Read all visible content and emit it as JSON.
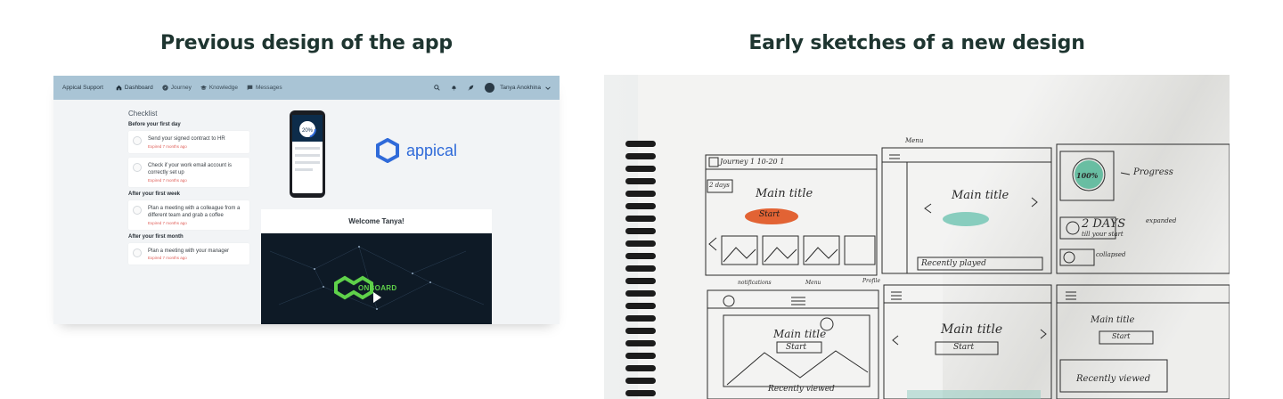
{
  "headings": {
    "left": "Previous design of the app",
    "right": "Early sketches of a new design"
  },
  "app": {
    "brand": "Appical Support",
    "nav": [
      {
        "label": "Dashboard",
        "icon": "home-icon",
        "active": true
      },
      {
        "label": "Journey",
        "icon": "compass-icon",
        "active": false
      },
      {
        "label": "Knowledge",
        "icon": "graduation-cap-icon",
        "active": false
      },
      {
        "label": "Messages",
        "icon": "chat-icon",
        "active": false
      }
    ],
    "user_name": "Tanya Anokhina",
    "checklist": {
      "title": "Checklist",
      "sections": [
        {
          "name": "Before your first day",
          "items": [
            {
              "text": "Send your signed contract to HR",
              "status": "Expired 7 months ago"
            },
            {
              "text": "Check if your work email account is correctly set up",
              "status": "Expired 7 months ago"
            }
          ]
        },
        {
          "name": "After your first week",
          "items": [
            {
              "text": "Plan a meeting with a colleague from a different team and grab a coffee",
              "status": "Expired 7 months ago"
            }
          ]
        },
        {
          "name": "After your first month",
          "items": [
            {
              "text": "Plan a meeting with your manager",
              "status": "Expired 7 months ago"
            }
          ]
        }
      ]
    },
    "phone_progress": "20%",
    "logo_text": "appical",
    "welcome": "Welcome Tanya!",
    "video_text": "ONBOARD"
  },
  "sketch": {
    "labels": {
      "journey": "Journey 1 10-20 1",
      "days_small": "2 days",
      "main_title": "Main title",
      "start": "Start",
      "recently_played": "Recently played",
      "recently_viewed": "Recently viewed",
      "menu": "Menu",
      "progress_value": "100%",
      "progress": "Progress",
      "days_big": "2 DAYS",
      "fill_your_sheet": "till your start",
      "expanded": "expanded",
      "collapsed": "collapsed",
      "notifications": "notifications",
      "profile": "Profile"
    }
  }
}
